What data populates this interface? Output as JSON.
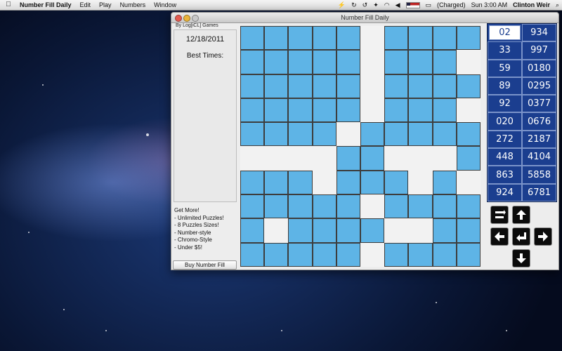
{
  "menubar": {
    "app_name": "Number Fill Daily",
    "menus": [
      "Edit",
      "Play",
      "Numbers",
      "Window"
    ],
    "battery_status": "(Charged)",
    "clock": "Sun 3:00 AM",
    "user": "Clinton Weir"
  },
  "window": {
    "title": "Number Fill Daily",
    "byline": "By Log[iCL] Games"
  },
  "left_panel": {
    "date": "12/18/2011",
    "best_times_label": "Best Times:",
    "promo_lines": [
      "Get More!",
      "- Unlimited Puzzles!",
      "- 8 Puzzles Sizes!",
      "- Number-style",
      "- Chromo-Style",
      "- Under $5!"
    ],
    "buy_button": "Buy Number Fill"
  },
  "grid": {
    "rows": [
      [
        1,
        1,
        1,
        1,
        1,
        0,
        1,
        1,
        1,
        1
      ],
      [
        1,
        1,
        1,
        1,
        1,
        0,
        1,
        1,
        1,
        0
      ],
      [
        1,
        1,
        1,
        1,
        1,
        0,
        1,
        1,
        1,
        1
      ],
      [
        1,
        1,
        1,
        1,
        1,
        0,
        1,
        1,
        1,
        0
      ],
      [
        1,
        1,
        1,
        1,
        0,
        1,
        1,
        1,
        1,
        1
      ],
      [
        0,
        0,
        0,
        0,
        1,
        1,
        0,
        0,
        0,
        1
      ],
      [
        1,
        1,
        1,
        0,
        1,
        1,
        1,
        0,
        1,
        0
      ],
      [
        1,
        1,
        1,
        1,
        1,
        0,
        1,
        1,
        1,
        1
      ],
      [
        1,
        0,
        1,
        1,
        1,
        1,
        0,
        0,
        1,
        1
      ],
      [
        1,
        1,
        1,
        1,
        1,
        0,
        1,
        1,
        1,
        1
      ]
    ],
    "filled_color": "#5eb4e6",
    "empty_color": "#f2f2f2"
  },
  "numbers": {
    "left": [
      "02",
      "33",
      "59",
      "89",
      "92",
      "020",
      "272",
      "448",
      "863",
      "924"
    ],
    "right": [
      "934",
      "997",
      "0180",
      "0295",
      "0377",
      "0676",
      "2187",
      "4104",
      "5858",
      "6781"
    ],
    "selected": "02",
    "panel_color": "#1b3e8f"
  },
  "controls": {
    "icons": [
      "toggle-icon",
      "arrow-up-icon",
      "arrow-left-icon",
      "enter-icon",
      "arrow-right-icon",
      "arrow-down-icon"
    ]
  }
}
